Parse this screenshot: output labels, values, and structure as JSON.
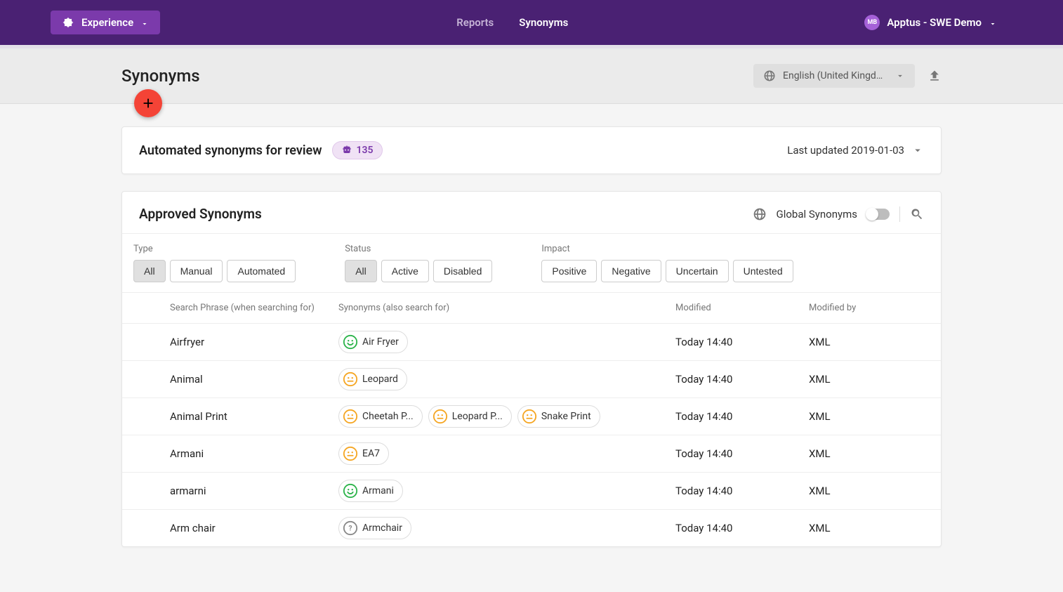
{
  "nav": {
    "experience_label": "Experience",
    "links": {
      "reports": "Reports",
      "synonyms": "Synonyms"
    },
    "account": {
      "initials": "MB",
      "label": "Apptus - SWE Demo"
    }
  },
  "header": {
    "title": "Synonyms",
    "language": "English (United Kingdo..."
  },
  "review": {
    "title": "Automated synonyms for review",
    "count": "135",
    "last_updated_label": "Last updated 2019-01-03"
  },
  "approved": {
    "title": "Approved Synonyms",
    "scope_label": "Global Synonyms"
  },
  "filters": {
    "type_label": "Type",
    "status_label": "Status",
    "impact_label": "Impact",
    "type": [
      "All",
      "Manual",
      "Automated"
    ],
    "status": [
      "All",
      "Active",
      "Disabled"
    ],
    "impact": [
      "Positive",
      "Negative",
      "Uncertain",
      "Untested"
    ]
  },
  "columns": {
    "phrase": "Search Phrase (when searching for)",
    "synonyms": "Synonyms (also search for)",
    "modified": "Modified",
    "modified_by": "Modified by"
  },
  "rows": [
    {
      "phrase": "Airfryer",
      "syns": [
        {
          "label": "Air Fryer",
          "mood": "positive"
        }
      ],
      "modified": "Today 14:40",
      "by": "XML"
    },
    {
      "phrase": "Animal",
      "syns": [
        {
          "label": "Leopard",
          "mood": "neutral"
        }
      ],
      "modified": "Today 14:40",
      "by": "XML"
    },
    {
      "phrase": "Animal Print",
      "syns": [
        {
          "label": "Cheetah P...",
          "mood": "neutral"
        },
        {
          "label": "Leopard P...",
          "mood": "neutral"
        },
        {
          "label": "Snake Print",
          "mood": "neutral"
        }
      ],
      "modified": "Today 14:40",
      "by": "XML"
    },
    {
      "phrase": "Armani",
      "syns": [
        {
          "label": "EA7",
          "mood": "neutral"
        }
      ],
      "modified": "Today 14:40",
      "by": "XML"
    },
    {
      "phrase": "armarni",
      "syns": [
        {
          "label": "Armani",
          "mood": "positive"
        }
      ],
      "modified": "Today 14:40",
      "by": "XML"
    },
    {
      "phrase": "Arm chair",
      "syns": [
        {
          "label": "Armchair",
          "mood": "unknown"
        }
      ],
      "modified": "Today 14:40",
      "by": "XML"
    }
  ]
}
